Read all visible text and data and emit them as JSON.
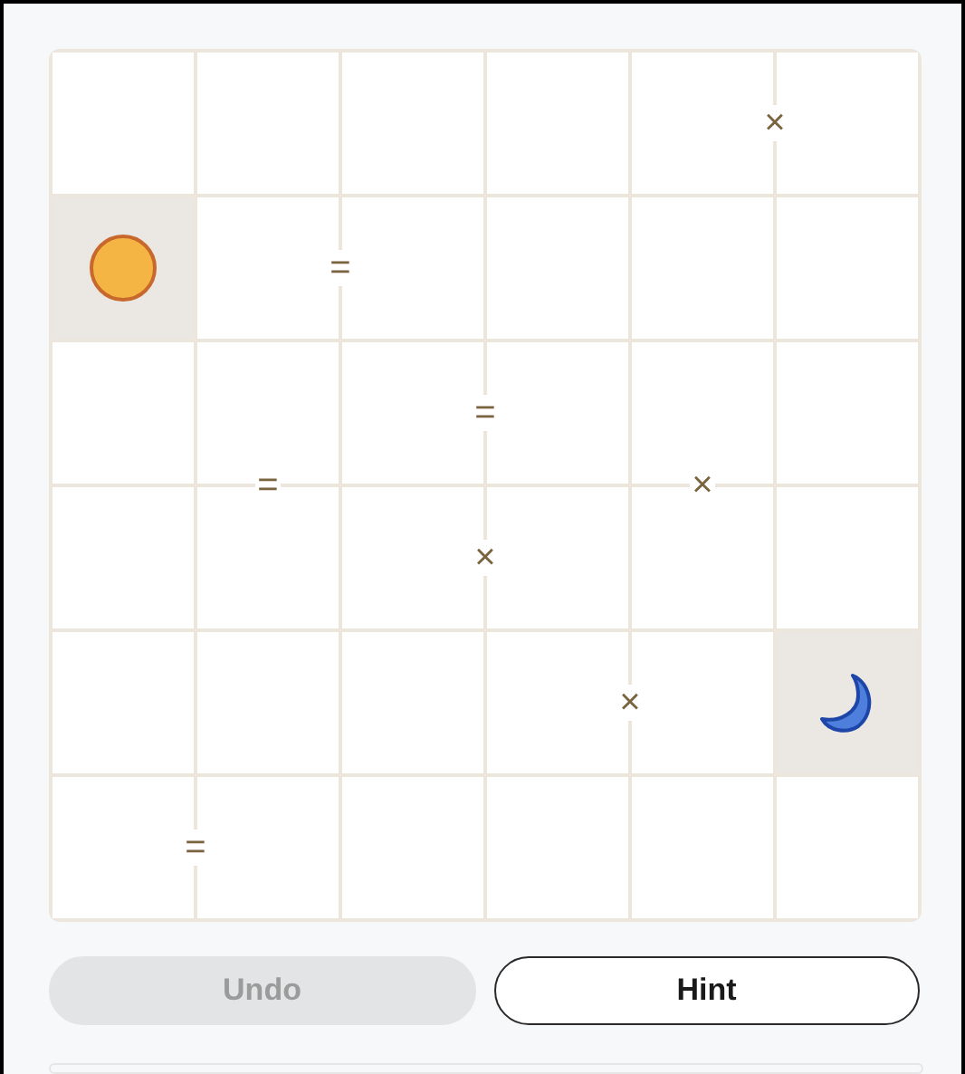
{
  "board": {
    "rows": [
      {
        "cells": [
          {
            "locked": false
          },
          {
            "locked": false
          },
          {
            "locked": false
          },
          {
            "locked": false
          },
          {
            "locked": false,
            "right": "×"
          },
          {
            "locked": false
          }
        ]
      },
      {
        "cells": [
          {
            "kind": "sun",
            "locked": true
          },
          {
            "locked": false,
            "right": "="
          },
          {
            "locked": false
          },
          {
            "locked": false
          },
          {
            "locked": false
          },
          {
            "locked": false
          }
        ]
      },
      {
        "cells": [
          {
            "locked": false
          },
          {
            "locked": false,
            "below": "="
          },
          {
            "locked": false,
            "right": "="
          },
          {
            "locked": false
          },
          {
            "locked": false,
            "below": "×"
          },
          {
            "locked": false
          }
        ]
      },
      {
        "cells": [
          {
            "locked": false
          },
          {
            "locked": false
          },
          {
            "locked": false,
            "right": "×"
          },
          {
            "locked": false
          },
          {
            "locked": false
          },
          {
            "locked": false
          }
        ]
      },
      {
        "cells": [
          {
            "locked": false
          },
          {
            "locked": false
          },
          {
            "locked": false
          },
          {
            "locked": false,
            "right": "×"
          },
          {
            "locked": false
          },
          {
            "kind": "moon",
            "locked": true
          }
        ]
      },
      {
        "cells": [
          {
            "locked": false,
            "right": "="
          },
          {
            "locked": false
          },
          {
            "locked": false
          },
          {
            "locked": false
          },
          {
            "locked": false
          },
          {
            "locked": false
          }
        ]
      }
    ]
  },
  "buttons": [
    {
      "label": "Undo",
      "disabled": true
    },
    {
      "label": "Hint",
      "disabled": false
    }
  ]
}
